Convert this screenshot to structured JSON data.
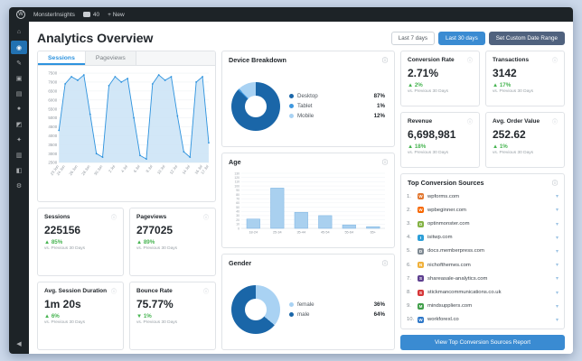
{
  "admin_bar": {
    "site": "MonsterInsights",
    "comments": "40",
    "new_label": "+ New",
    "wp_glyph": "W"
  },
  "sidebar": {
    "items": [
      {
        "name": "dashboard-icon",
        "glyph": "⌂"
      },
      {
        "name": "monsterinsights-icon",
        "glyph": "◉",
        "active": true
      },
      {
        "name": "posts-icon",
        "glyph": "✎"
      },
      {
        "name": "media-icon",
        "glyph": "▣"
      },
      {
        "name": "pages-icon",
        "glyph": "▤"
      },
      {
        "name": "comments-icon",
        "glyph": "●"
      },
      {
        "name": "appearance-icon",
        "glyph": "◩"
      },
      {
        "name": "plugins-icon",
        "glyph": "✦"
      },
      {
        "name": "users-icon",
        "glyph": "▥"
      },
      {
        "name": "tools-icon",
        "glyph": "◧"
      },
      {
        "name": "settings-icon",
        "glyph": "⚙"
      },
      {
        "name": "collapse-menu-icon",
        "glyph": "◀",
        "bottom": true
      }
    ]
  },
  "page": {
    "title": "Analytics Overview"
  },
  "buttons": {
    "last7": "Last 7 days",
    "last30": "Last 30 days",
    "custom": "Set Custom Date Range"
  },
  "tabs": {
    "sessions": "Sessions",
    "pageviews": "Pageviews"
  },
  "stats_left": [
    {
      "label": "Sessions",
      "value": "225156",
      "change": "▲ 85%",
      "note": "vs. Previous 30 Days"
    },
    {
      "label": "Pageviews",
      "value": "277025",
      "change": "▲ 89%",
      "note": "vs. Previous 30 Days"
    },
    {
      "label": "Avg. Session Duration",
      "value": "1m 20s",
      "change": "▲ 6%",
      "note": "vs. Previous 30 Days"
    },
    {
      "label": "Bounce Rate",
      "value": "75.77%",
      "change": "▼ 1%",
      "note": "vs. Previous 30 Days"
    }
  ],
  "stats_right": [
    {
      "label": "Conversion Rate",
      "value": "2.71%",
      "change": "▲ 2%",
      "note": "vs. Previous 30 Days"
    },
    {
      "label": "Transactions",
      "value": "3142",
      "change": "▲ 17%",
      "note": "vs. Previous 30 Days"
    },
    {
      "label": "Revenue",
      "value": "6,698,981",
      "change": "▲ 18%",
      "note": "vs. Previous 30 Days"
    },
    {
      "label": "Avg. Order Value",
      "value": "252.62",
      "change": "▲ 1%",
      "note": "vs. Previous 30 Days"
    }
  ],
  "sources": {
    "title": "Top Conversion Sources",
    "items": [
      {
        "rank": "1.",
        "domain": "wpforms.com",
        "color": "#e27730"
      },
      {
        "rank": "2.",
        "domain": "wpbeginner.com",
        "color": "#f76700"
      },
      {
        "rank": "3.",
        "domain": "optinmonster.com",
        "color": "#83b244"
      },
      {
        "rank": "4.",
        "domain": "isitwp.com",
        "color": "#2d9fd8"
      },
      {
        "rank": "5.",
        "domain": "docs.memberpress.com",
        "color": "#7f8a93"
      },
      {
        "rank": "6.",
        "domain": "nichofthemes.com",
        "color": "#f0b13c"
      },
      {
        "rank": "7.",
        "domain": "shareasale-analytics.com",
        "color": "#5d3f8f"
      },
      {
        "rank": "8.",
        "domain": "stickmancommunications.co.uk",
        "color": "#d63638"
      },
      {
        "rank": "9.",
        "domain": "mindsuppliers.com",
        "color": "#3f9e49"
      },
      {
        "rank": "10.",
        "domain": "workforexl.co",
        "color": "#2d77c8"
      }
    ],
    "button": "View Top Conversion Sources Report"
  },
  "chart_data": [
    {
      "id": "sessions",
      "type": "area",
      "title": "Sessions",
      "x": [
        "23 Jun",
        "24 Jun",
        "25 Jun",
        "26 Jun",
        "27 Jun",
        "28 Jun",
        "29 Jun",
        "30 Jun",
        "1 Jul",
        "2 Jul",
        "3 Jul",
        "4 Jul",
        "5 Jul",
        "6 Jul",
        "7 Jul",
        "8 Jul",
        "9 Jul",
        "10 Jul",
        "11 Jul",
        "12 Jul",
        "13 Jul",
        "14 Jul",
        "15 Jul",
        "16 Jul",
        "17 Jul"
      ],
      "values": [
        4300,
        6900,
        7300,
        7100,
        7400,
        5200,
        3000,
        2800,
        6800,
        7300,
        7000,
        7200,
        5000,
        2900,
        2700,
        6900,
        7400,
        7100,
        7300,
        5100,
        3100,
        2800,
        7000,
        7300,
        3600
      ],
      "ylim": [
        2500,
        7500
      ],
      "ytick": 500,
      "xticks": [
        "23 Jun",
        "24 Jun",
        "26 Jun",
        "28 Jun",
        "30 Jun",
        "2 Jul",
        "4 Jul",
        "6 Jul",
        "8 Jul",
        "10 Jul",
        "12 Jul",
        "14 Jul",
        "16 Jul",
        "17 Jul"
      ],
      "xtick_idx": [
        0,
        1,
        3,
        5,
        7,
        9,
        11,
        13,
        15,
        17,
        19,
        21,
        23,
        24
      ],
      "line_color": "#2e93de",
      "fill_color": "#cde4f6"
    },
    {
      "id": "device",
      "type": "pie",
      "title": "Device Breakdown",
      "labels": [
        "Desktop",
        "Tablet",
        "Mobile"
      ],
      "values": [
        87,
        1,
        12
      ],
      "pct": [
        "87%",
        "1%",
        "12%"
      ],
      "colors": [
        "#1a66a8",
        "#3e97de",
        "#a9d2f3"
      ]
    },
    {
      "id": "age",
      "type": "bar",
      "title": "Age",
      "categories": [
        "18-24",
        "25-34",
        "35-44",
        "45-54",
        "55-64",
        "65+"
      ],
      "values": [
        22,
        95,
        38,
        30,
        8,
        4
      ],
      "ylim": [
        0,
        130
      ],
      "ytick": 10,
      "bar_color": "#a9d0ef"
    },
    {
      "id": "gender",
      "type": "pie",
      "title": "Gender",
      "labels": [
        "female",
        "male"
      ],
      "values": [
        36,
        64
      ],
      "pct": [
        "36%",
        "64%"
      ],
      "colors": [
        "#a9d2f3",
        "#1a66a8"
      ]
    }
  ]
}
